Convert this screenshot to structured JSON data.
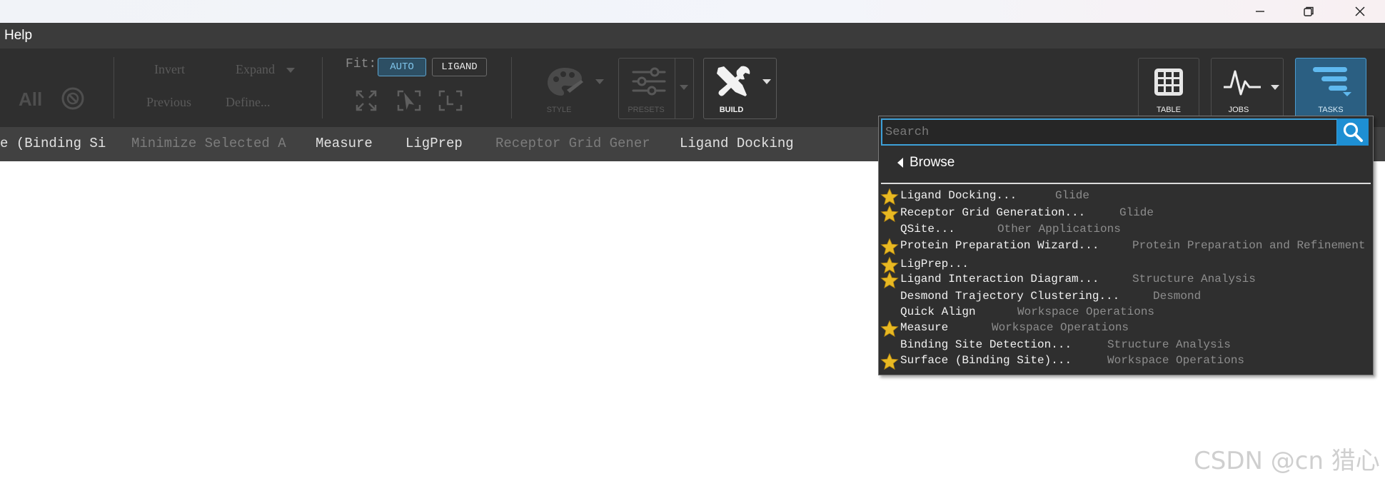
{
  "window": {
    "minimize_icon": "minimize-icon",
    "restore_icon": "restore-icon",
    "close_icon": "close-icon"
  },
  "menu": {
    "help": "Help"
  },
  "toolbar": {
    "all_label": "All",
    "invert": "Invert",
    "expand": "Expand",
    "previous": "Previous",
    "define": "Define...",
    "fit_label": "Fit:",
    "fit_auto": "AUTO",
    "fit_ligand": "LIGAND",
    "style": "STYLE",
    "presets": "PRESETS",
    "build": "BUILD",
    "table": "TABLE",
    "jobs": "JOBS",
    "tasks": "TASKS"
  },
  "favorites": [
    {
      "label": "e (Binding Si",
      "enabled": true
    },
    {
      "label": "Minimize Selected A",
      "enabled": false
    },
    {
      "label": "Measure",
      "enabled": true
    },
    {
      "label": "LigPrep",
      "enabled": true
    },
    {
      "label": "Receptor Grid Gener",
      "enabled": false
    },
    {
      "label": "Ligand Docking",
      "enabled": true
    }
  ],
  "tasks_menu": {
    "search_placeholder": "Search",
    "search_value": "",
    "browse_label": "Browse",
    "results": [
      {
        "title": "Ligand Docking...",
        "category": "Glide",
        "favorite": true
      },
      {
        "title": "Receptor Grid Generation...",
        "category": "Glide",
        "favorite": true
      },
      {
        "title": "QSite...",
        "category": "Other Applications",
        "favorite": false
      },
      {
        "title": "Protein Preparation Wizard...",
        "category": "Protein Preparation and Refinement",
        "favorite": true
      },
      {
        "title": "LigPrep...",
        "category": "",
        "favorite": true
      },
      {
        "title": "Ligand Interaction Diagram...",
        "category": "Structure Analysis",
        "favorite": true
      },
      {
        "title": "Desmond Trajectory Clustering...",
        "category": "Desmond",
        "favorite": false
      },
      {
        "title": "Quick Align",
        "category": "Workspace Operations",
        "favorite": false
      },
      {
        "title": "Measure",
        "category": "Workspace Operations",
        "favorite": true
      },
      {
        "title": "Binding Site Detection...",
        "category": "Structure Analysis",
        "favorite": false
      },
      {
        "title": "Surface (Binding Site)...",
        "category": "Workspace Operations",
        "favorite": true
      }
    ]
  },
  "watermark": "CSDN @cn 猎心"
}
